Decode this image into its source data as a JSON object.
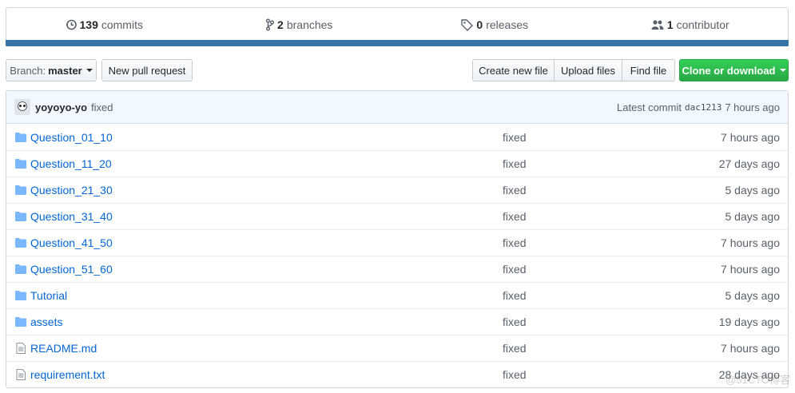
{
  "summary": {
    "commits": {
      "count": "139",
      "label": "commits",
      "icon": "history-icon"
    },
    "branches": {
      "count": "2",
      "label": "branches",
      "icon": "git-branch-icon"
    },
    "releases": {
      "count": "0",
      "label": "releases",
      "icon": "tag-icon"
    },
    "contributors": {
      "count": "1",
      "label": "contributor",
      "icon": "people-icon"
    },
    "language_color": "#3572A5"
  },
  "toolbar": {
    "branch_prefix": "Branch:",
    "branch_name": "master",
    "new_pull_request": "New pull request",
    "create_new_file": "Create new file",
    "upload_files": "Upload files",
    "find_file": "Find file",
    "clone_or_download": "Clone or download"
  },
  "commit": {
    "author": "yoyoyo-yo",
    "message": "fixed",
    "latest_label": "Latest commit",
    "sha": "dac1213",
    "age": "7 hours ago"
  },
  "files": [
    {
      "type": "dir",
      "name": "Question_01_10",
      "message": "fixed",
      "age": "7 hours ago"
    },
    {
      "type": "dir",
      "name": "Question_11_20",
      "message": "fixed",
      "age": "27 days ago"
    },
    {
      "type": "dir",
      "name": "Question_21_30",
      "message": "fixed",
      "age": "5 days ago"
    },
    {
      "type": "dir",
      "name": "Question_31_40",
      "message": "fixed",
      "age": "5 days ago"
    },
    {
      "type": "dir",
      "name": "Question_41_50",
      "message": "fixed",
      "age": "7 hours ago"
    },
    {
      "type": "dir",
      "name": "Question_51_60",
      "message": "fixed",
      "age": "7 hours ago"
    },
    {
      "type": "dir",
      "name": "Tutorial",
      "message": "fixed",
      "age": "5 days ago"
    },
    {
      "type": "dir",
      "name": "assets",
      "message": "fixed",
      "age": "19 days ago"
    },
    {
      "type": "file",
      "name": "README.md",
      "message": "fixed",
      "age": "7 hours ago"
    },
    {
      "type": "file",
      "name": "requirement.txt",
      "message": "fixed",
      "age": "28 days ago"
    }
  ],
  "watermark": "@51CTO博客",
  "colors": {
    "link": "#0366d6",
    "folder": "#79b8ff",
    "green": "#28a745"
  }
}
